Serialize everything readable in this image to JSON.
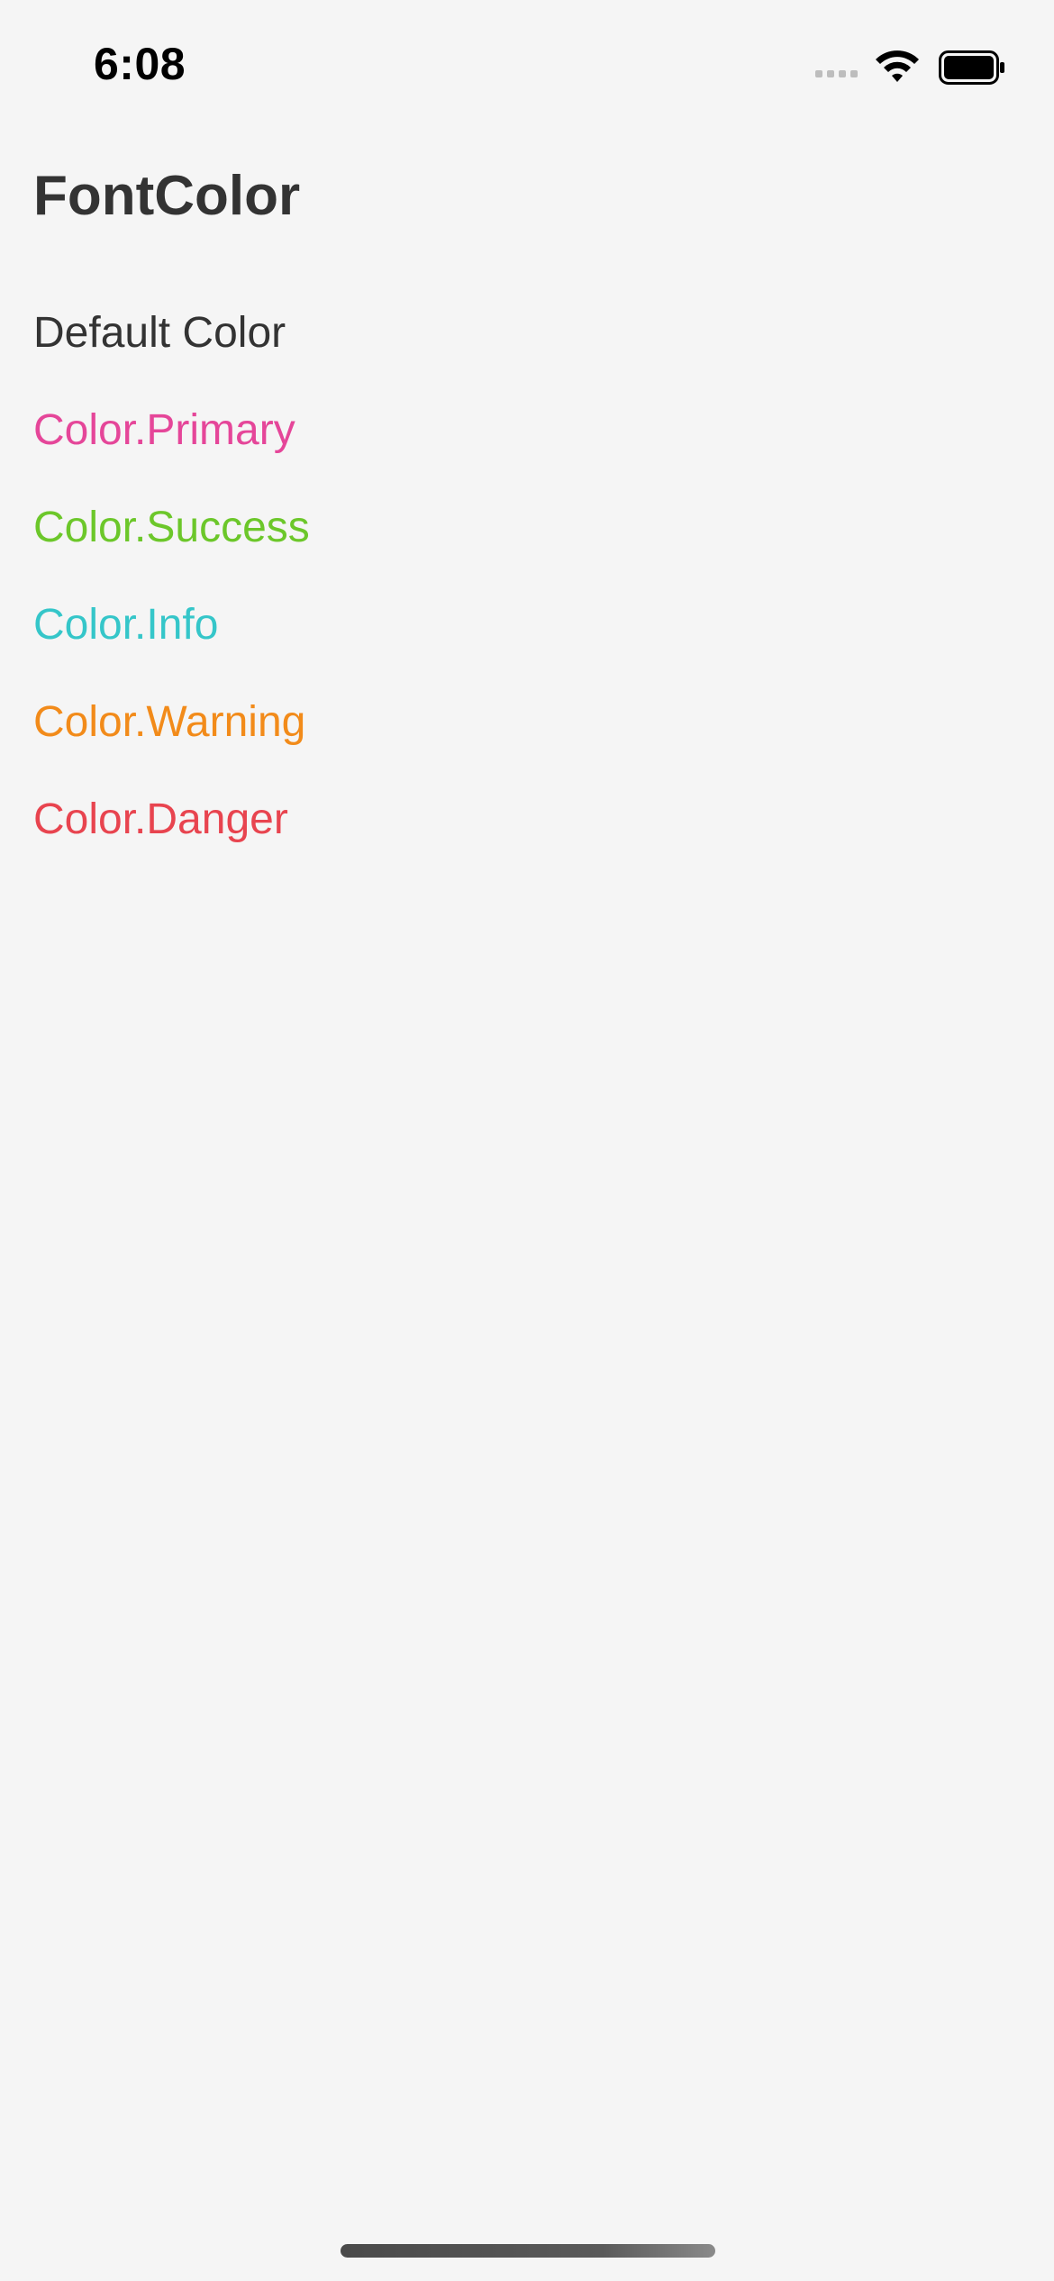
{
  "status_bar": {
    "time": "6:08"
  },
  "icons": {
    "signal": "cellular-signal-icon",
    "wifi": "wifi-icon",
    "battery": "battery-icon"
  },
  "page": {
    "title": "FontColor"
  },
  "color_items": [
    {
      "label": "Default Color",
      "color": "#333333"
    },
    {
      "label": "Color.Primary",
      "color": "#e54699"
    },
    {
      "label": "Color.Success",
      "color": "#6cc72a"
    },
    {
      "label": "Color.Info",
      "color": "#35c6c9"
    },
    {
      "label": "Color.Warning",
      "color": "#f28b1a"
    },
    {
      "label": "Color.Danger",
      "color": "#e8444f"
    }
  ]
}
